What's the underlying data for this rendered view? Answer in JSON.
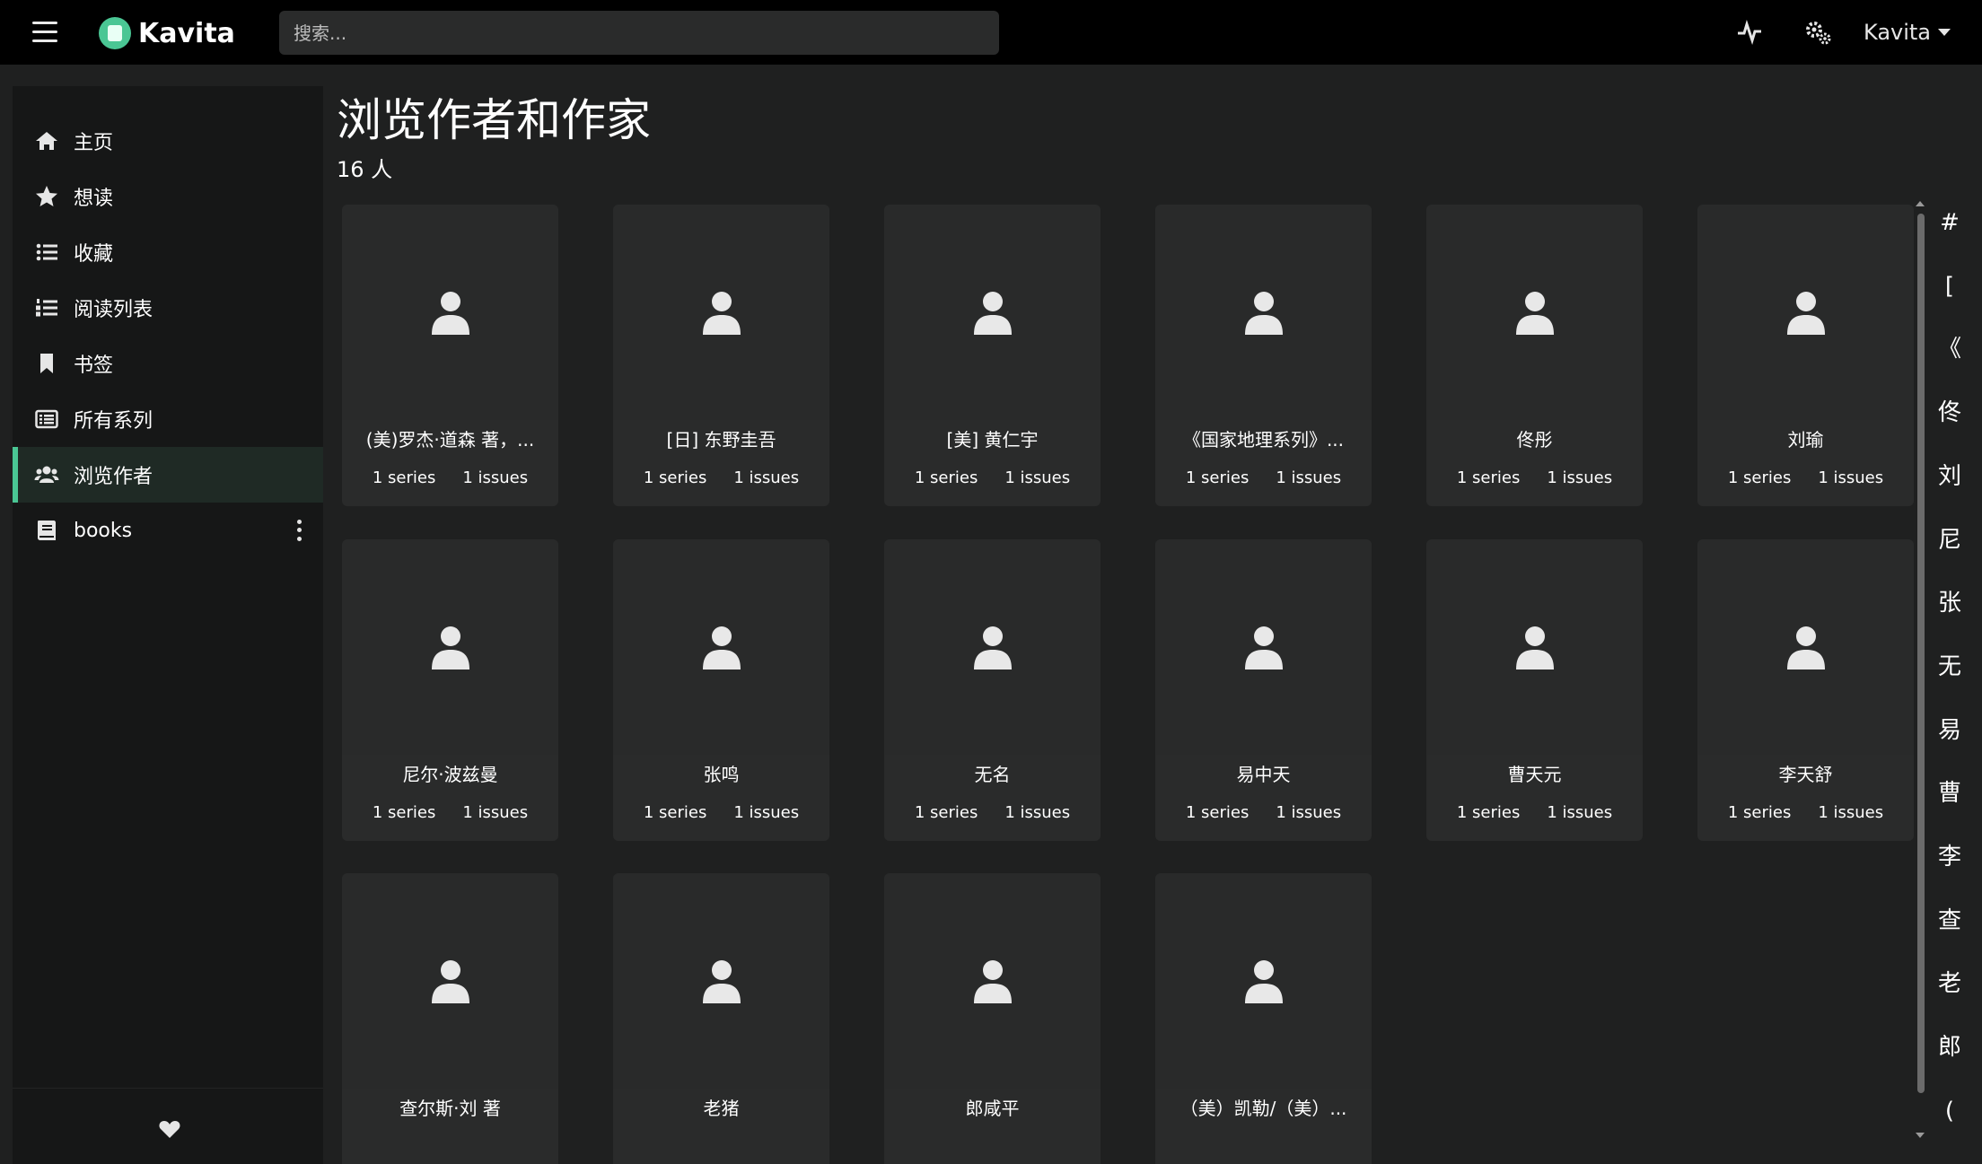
{
  "header": {
    "brand": "Kavita",
    "search_placeholder": "搜索...",
    "user_label": "Kavita",
    "icons": [
      "menu-icon",
      "activity-icon",
      "settings-icon"
    ]
  },
  "sidebar": {
    "items": [
      {
        "label": "主页",
        "icon": "home-icon"
      },
      {
        "label": "想读",
        "icon": "star-icon"
      },
      {
        "label": "收藏",
        "icon": "list-icon"
      },
      {
        "label": "阅读列表",
        "icon": "ordered-list-icon"
      },
      {
        "label": "书签",
        "icon": "bookmark-icon"
      },
      {
        "label": "所有系列",
        "icon": "rectangle-list-icon"
      },
      {
        "label": "浏览作者",
        "icon": "users-icon",
        "active": true
      },
      {
        "label": "books",
        "icon": "book-icon"
      }
    ],
    "footer_icon": "heart-icon"
  },
  "main": {
    "title": "浏览作者和作家",
    "subtitle": "16 人",
    "authors": [
      {
        "name": "(美)罗杰·道森 著，...",
        "series": "1 series",
        "issues": "1 issues"
      },
      {
        "name": "[日] 东野圭吾",
        "series": "1 series",
        "issues": "1 issues"
      },
      {
        "name": "[美] 黄仁宇",
        "series": "1 series",
        "issues": "1 issues"
      },
      {
        "name": "《国家地理系列》...",
        "series": "1 series",
        "issues": "1 issues"
      },
      {
        "name": "佟彤",
        "series": "1 series",
        "issues": "1 issues"
      },
      {
        "name": "刘瑜",
        "series": "1 series",
        "issues": "1 issues"
      },
      {
        "name": "尼尔·波兹曼",
        "series": "1 series",
        "issues": "1 issues"
      },
      {
        "name": "张鸣",
        "series": "1 series",
        "issues": "1 issues"
      },
      {
        "name": "无名",
        "series": "1 series",
        "issues": "1 issues"
      },
      {
        "name": "易中天",
        "series": "1 series",
        "issues": "1 issues"
      },
      {
        "name": "曹天元",
        "series": "1 series",
        "issues": "1 issues"
      },
      {
        "name": "李天舒",
        "series": "1 series",
        "issues": "1 issues"
      },
      {
        "name": "查尔斯·刘 著",
        "series": "",
        "issues": ""
      },
      {
        "name": "老猪",
        "series": "",
        "issues": ""
      },
      {
        "name": "郎咸平",
        "series": "",
        "issues": ""
      },
      {
        "name": "（美）凯勒/（美）...",
        "series": "",
        "issues": ""
      }
    ]
  },
  "jumpbar": [
    "#",
    "[",
    "《",
    "佟",
    "刘",
    "尼",
    "张",
    "无",
    "易",
    "曹",
    "李",
    "查",
    "老",
    "郎",
    "("
  ],
  "colors": {
    "accent": "#4ac694",
    "background": "#1f2020",
    "card": "#2a2b2b",
    "topbar": "#000000"
  }
}
